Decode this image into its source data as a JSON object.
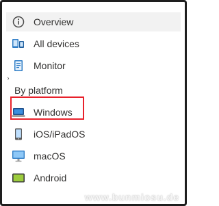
{
  "nav": {
    "items": [
      {
        "label": "Overview",
        "icon": "info-icon",
        "selected": true
      },
      {
        "label": "All devices",
        "icon": "devices-icon"
      },
      {
        "label": "Monitor",
        "icon": "monitor-icon"
      }
    ],
    "section_header": "By platform",
    "platforms": [
      {
        "label": "Windows",
        "icon": "windows-laptop-icon",
        "highlighted": true
      },
      {
        "label": "iOS/iPadOS",
        "icon": "ios-phone-icon"
      },
      {
        "label": "macOS",
        "icon": "macos-monitor-icon"
      },
      {
        "label": "Android",
        "icon": "android-tablet-icon"
      }
    ]
  },
  "colors": {
    "selected_background": "#f2f2f2",
    "highlight_border": "#e8212b",
    "icon_blue": "#2f7dc6",
    "android_green": "#7cb342"
  },
  "watermark": "www.bunmiosu.de"
}
